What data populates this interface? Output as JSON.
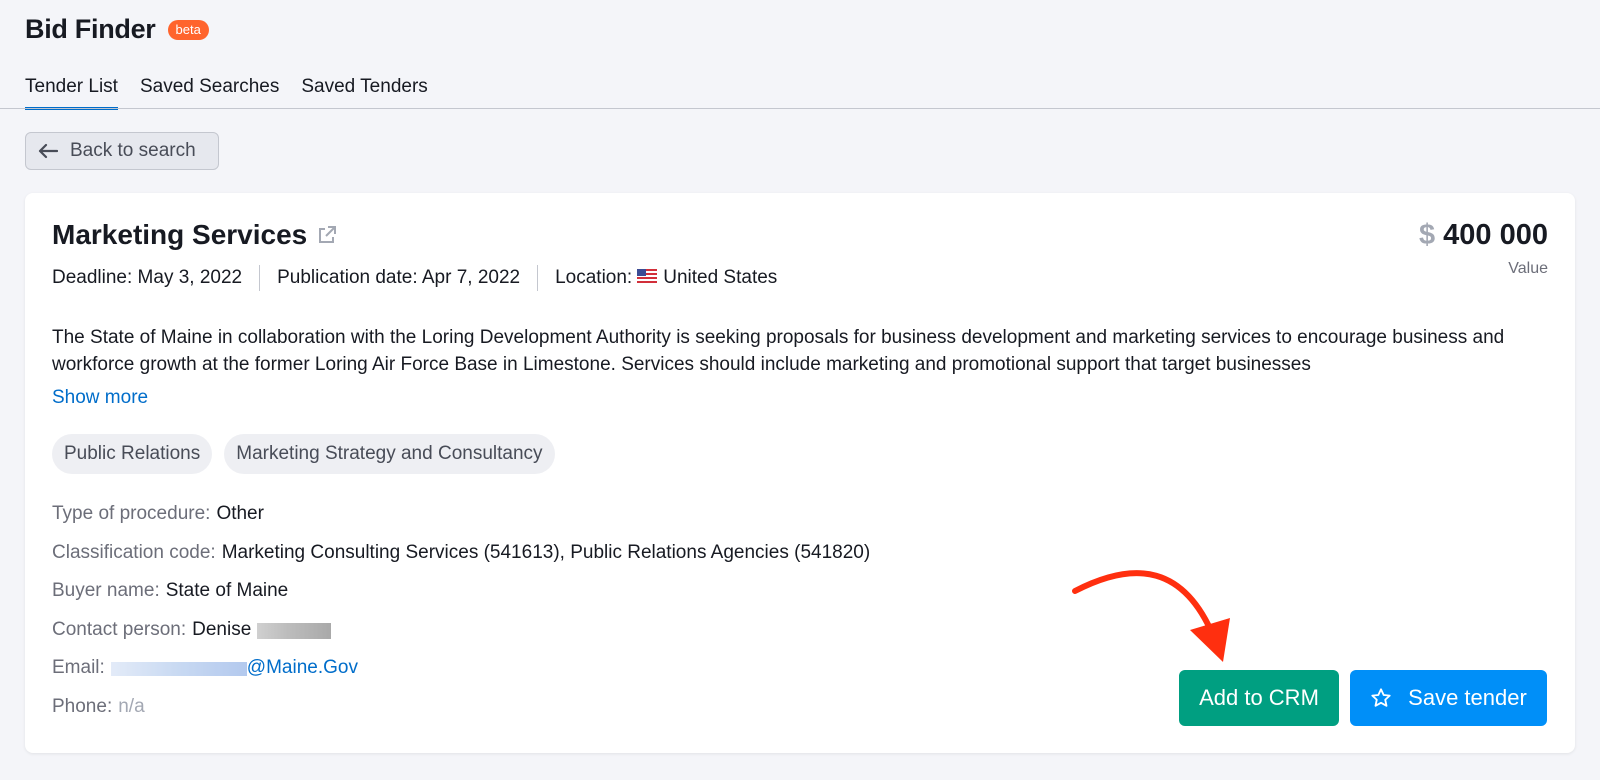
{
  "app": {
    "title": "Bid Finder",
    "badge": "beta"
  },
  "tabs": [
    {
      "label": "Tender List",
      "active": true
    },
    {
      "label": "Saved Searches",
      "active": false
    },
    {
      "label": "Saved Tenders",
      "active": false
    }
  ],
  "back_button": {
    "label": "Back to search"
  },
  "tender": {
    "title": "Marketing Services",
    "deadline": "Deadline: May 3, 2022",
    "publication": "Publication date: Apr 7, 2022",
    "location_label": "Location:",
    "location_value": "United States",
    "currency": "$",
    "value": "400 000",
    "value_label": "Value",
    "description": "The State of Maine in collaboration with the Loring Development Authority is seeking proposals for business development and marketing services to encourage business and workforce growth at the former Loring Air Force Base in Limestone. Services should include marketing and promotional support that target businesses",
    "show_more": "Show more",
    "tags": [
      "Public Relations",
      "Marketing Strategy and Consultancy"
    ],
    "details": {
      "procedure_label": "Type of procedure:",
      "procedure_value": "Other",
      "classification_label": "Classification code:",
      "classification_value": "Marketing Consulting Services (541613), Public Relations Agencies (541820)",
      "buyer_label": "Buyer name:",
      "buyer_value": "State of Maine",
      "contact_label": "Contact person:",
      "contact_value": "Denise",
      "email_label": "Email:",
      "email_value": "@Maine.Gov",
      "phone_label": "Phone:",
      "phone_value": "n/a"
    }
  },
  "actions": {
    "crm_label": "Add to CRM",
    "save_label": "Save tender"
  },
  "colors": {
    "crm": "#009f81",
    "save": "#008ff8",
    "beta": "#ff642d",
    "link": "#006dca",
    "annotation": "#ff2f0f"
  }
}
